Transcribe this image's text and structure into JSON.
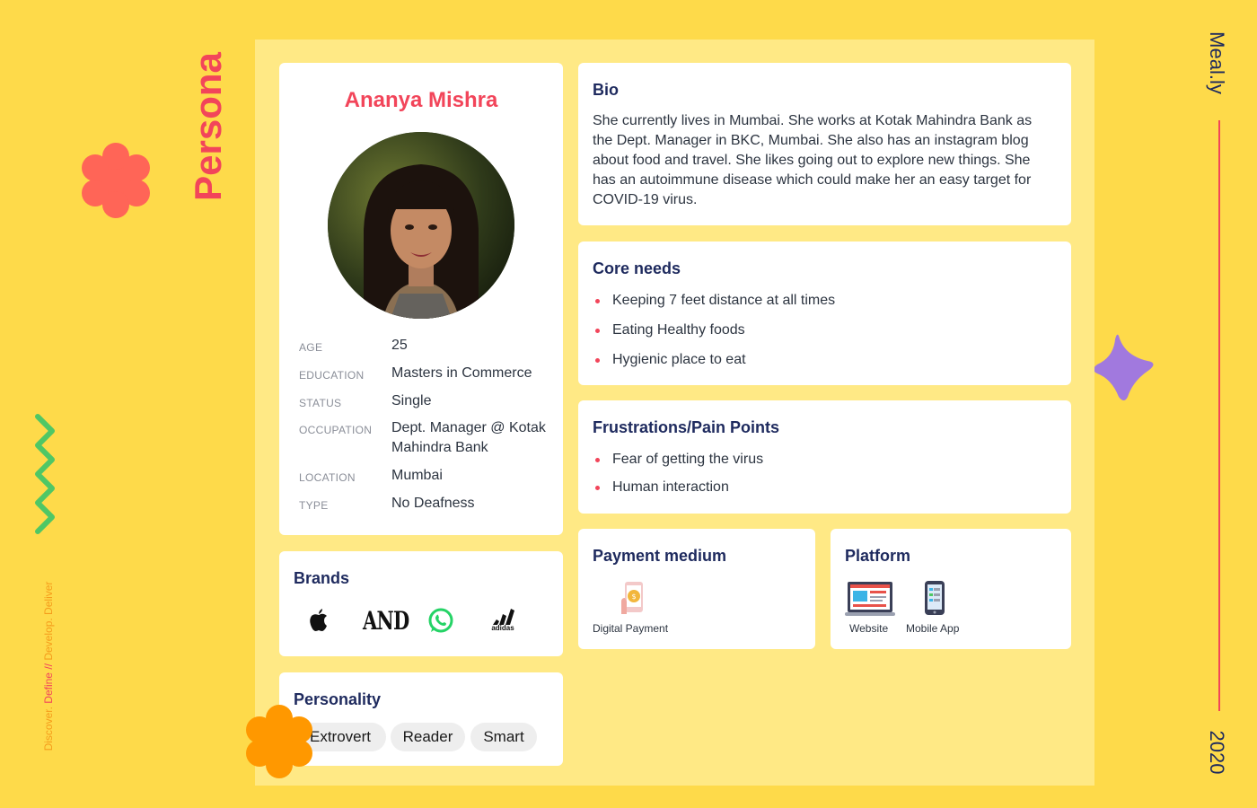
{
  "header": {
    "title": "Persona",
    "brand": "Meal.ly",
    "year": "2020"
  },
  "tagline": {
    "discover": "Discover.",
    "define": "Define //",
    "develop": "Develop.",
    "deliver": "Deliver"
  },
  "profile": {
    "name": "Ananya Mishra",
    "attributes": [
      {
        "label": "AGE",
        "value": "25"
      },
      {
        "label": "EDUCATION",
        "value": "Masters in Commerce"
      },
      {
        "label": "STATUS",
        "value": "Single"
      },
      {
        "label": "OCCUPATION",
        "value": "Dept. Manager @ Kotak Mahindra Bank"
      },
      {
        "label": "LOCATION",
        "value": "Mumbai"
      },
      {
        "label": "TYPE",
        "value": "No Deafness"
      }
    ]
  },
  "brands": {
    "title": "Brands",
    "logos": [
      "apple-logo",
      "and-logo",
      "whatsapp-logo",
      "adidas-logo"
    ],
    "and_text": "AND",
    "adidas_text": "adidas"
  },
  "personality": {
    "title": "Personality",
    "traits": [
      "Extrovert",
      "Reader",
      "Smart"
    ]
  },
  "bio": {
    "title": "Bio",
    "text": "She currently lives in Mumbai. She works at Kotak Mahindra Bank as the Dept. Manager in BKC, Mumbai. She also has an instagram blog about food and travel. She likes going out to explore new things. She has an autoimmune disease which could make her an easy target for  COVID-19 virus."
  },
  "core_needs": {
    "title": "Core needs",
    "items": [
      "Keeping 7 feet distance at all times",
      "Eating Healthy foods",
      "Hygienic place to eat"
    ]
  },
  "frustrations": {
    "title": "Frustrations/Pain Points",
    "items": [
      "Fear of getting the virus",
      "Human interaction"
    ]
  },
  "payment": {
    "title": "Payment medium",
    "items": [
      {
        "label": "Digital Payment",
        "icon": "digital-payment-icon"
      }
    ]
  },
  "platform": {
    "title": "Platform",
    "items": [
      {
        "label": "Website",
        "icon": "website-icon"
      },
      {
        "label": "Mobile App",
        "icon": "mobile-app-icon"
      }
    ]
  },
  "colors": {
    "background": "#FEDA4A",
    "board": "#FFE985",
    "accent_red": "#F2455A",
    "navy": "#1E2A5E",
    "purple": "#A179DE",
    "green": "#4FC765",
    "orange": "#FF9800",
    "coral": "#FF6557"
  }
}
